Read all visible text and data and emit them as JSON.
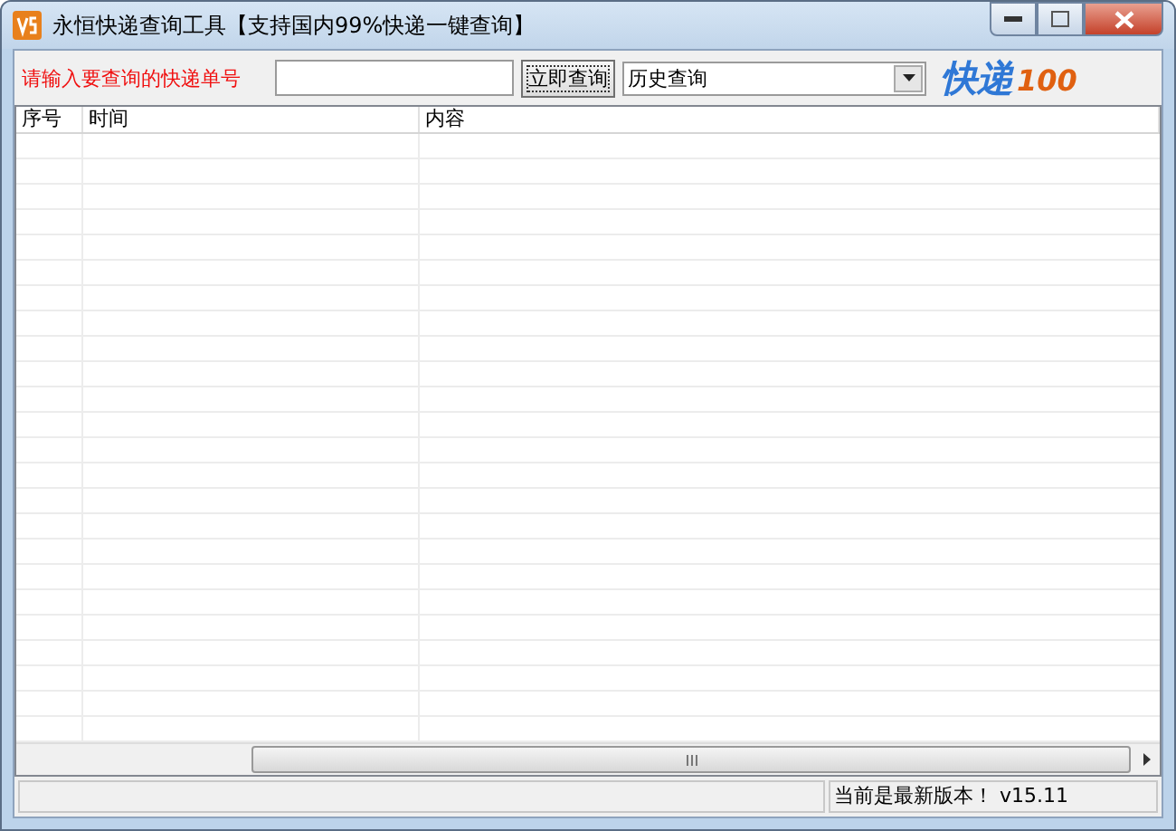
{
  "window": {
    "title": "永恒快递查询工具【支持国内99%快递一键查询】"
  },
  "toolbar": {
    "prompt": "请输入要查询的快递单号",
    "query_button": "立即查询",
    "history_dropdown": {
      "value": "历史查询"
    },
    "logo": {
      "text": "快递",
      "number": "100"
    }
  },
  "table": {
    "columns": [
      "序号",
      "时间",
      "内容"
    ]
  },
  "status_bar": {
    "message": "当前是最新版本！ v15.11"
  }
}
